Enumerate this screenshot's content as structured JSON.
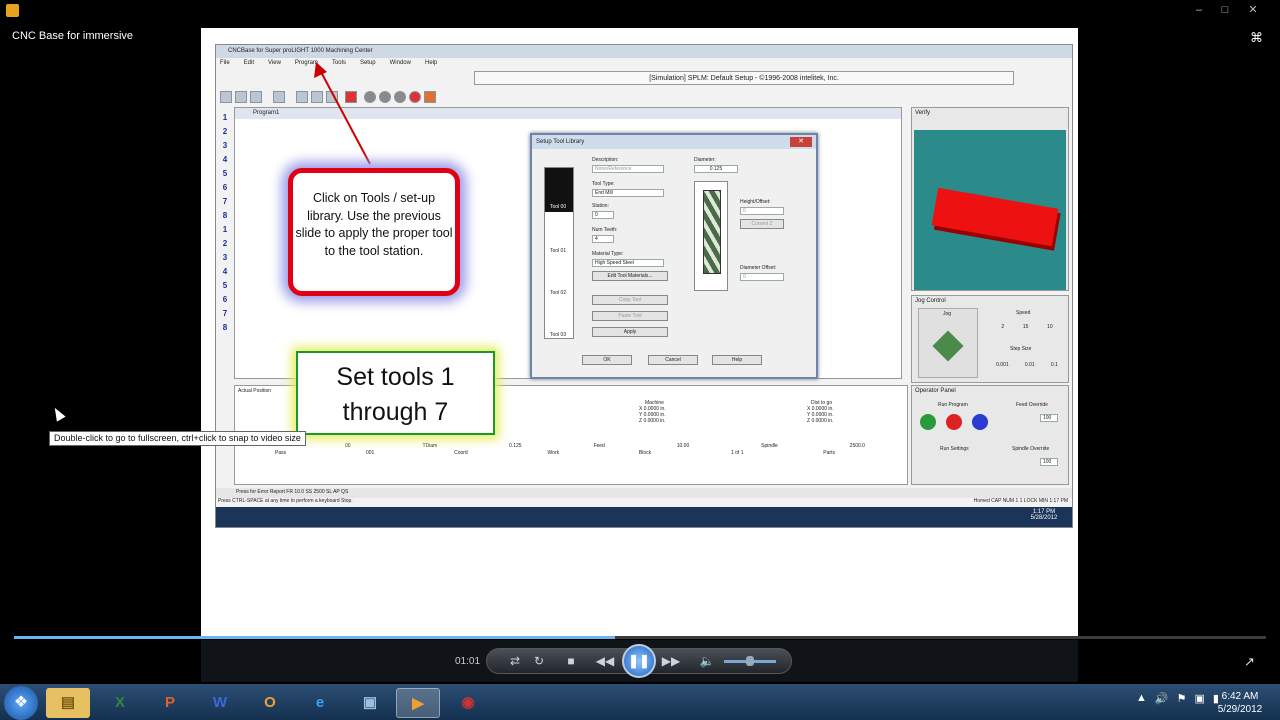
{
  "player": {
    "video_title": "CNC Base for immersive",
    "time": "01:01",
    "progress_fraction": 0.48,
    "volume_fraction": 0.5
  },
  "cnc": {
    "window_title": "CNCBase for Super proLIGHT 1000 Machining Center",
    "menu": [
      "File",
      "Edit",
      "View",
      "Program",
      "Tools",
      "Setup",
      "Window",
      "Help"
    ],
    "status": "[Simulation] SPLM: Default Setup - ©1996-2008 intelitek, Inc.",
    "program_title": "Program1",
    "line_numbers": [
      "1",
      "2",
      "3",
      "4",
      "5",
      "6",
      "7",
      "8",
      "1",
      "2",
      "3",
      "4",
      "5",
      "6",
      "7",
      "8"
    ],
    "dialog": {
      "title": "Setup Tool Library",
      "description_label": "Description:",
      "description_value": "None/Reference",
      "tool_type_label": "Tool Type:",
      "tool_type_value": "End Mill",
      "station_label": "Station:",
      "station_value": "0",
      "num_teeth_label": "Num Teeth:",
      "num_teeth_value": "4",
      "material_label": "Material Type:",
      "material_value": "High Speed Steel",
      "edit_materials": "Edit Tool Materials...",
      "copy_tool": "Copy Tool",
      "paste_tool": "Paste Tool",
      "apply": "Apply",
      "diameter_label": "Diameter:",
      "diameter_value": "0.125",
      "height_label": "Height/Offset:",
      "height_value": "0",
      "current_z": "Current Z",
      "diam_offset_label": "Diameter Offset:",
      "diam_offset_value": "0",
      "tools": [
        "Tool 00",
        "Tool 01",
        "Tool 02",
        "Tool 03"
      ],
      "ok": "OK",
      "cancel": "Cancel",
      "help": "Help"
    },
    "verify_title": "Verify",
    "jog_title": "Jog Control",
    "jog_label": "Jog",
    "speed_label": "Speed",
    "speed_values": [
      "2",
      "15",
      "10"
    ],
    "step_size_label": "Step Size",
    "step_values": [
      "0.001",
      "0.01",
      "0.1"
    ],
    "operator_title": "Operator Panel",
    "run_program": "Run Program",
    "feed_override": "Feed Override",
    "run_settings": "Run Settings",
    "spindle_override": "Spindle Override",
    "feed_override_value": "100",
    "spindle_override_value": "100",
    "actual_position_title": "Actual Position",
    "position_headers": [
      "Machine",
      "Dist to go"
    ],
    "position_rows": [
      "X 0.0000 in.",
      "Y 0.0000 in.",
      "Z 0.0000 in."
    ],
    "stats_row1": [
      "00",
      "TDiam",
      "0.125",
      "Feed",
      "10.00",
      "Spindle",
      "2500.0"
    ],
    "stats_row2": [
      "Pass",
      "001",
      "Coord",
      "Work",
      "Block",
      "1 of 1",
      "Parts"
    ],
    "errbar": "Press for Error Report    FR  10.0   SS  2500   SL          AP          QS",
    "hint": "Press CTRL-SPACE at any time to perform a keyboard Stop.",
    "status_right": "Homed  CAP  NUM    1      1          LOCK  MIN  1:17 PM",
    "taskbar_time": "1:17 PM",
    "taskbar_date": "5/28/2012"
  },
  "callouts": {
    "tools_text": "Click on Tools / set-up library. Use the previous slide to apply the proper tool to the tool station.",
    "set_text_line1": "Set tools 1",
    "set_text_line2": "through 7",
    "tooltip": "Double-click to go to fullscreen, ctrl+click to snap to video size"
  },
  "taskbar": {
    "time": "6:42 AM",
    "date": "5/29/2012",
    "apps": [
      "folder-icon",
      "excel-icon",
      "powerpoint-icon",
      "word-icon",
      "outlook-icon",
      "ie-icon",
      "network-icon",
      "media-player-icon",
      "game-icon"
    ]
  }
}
